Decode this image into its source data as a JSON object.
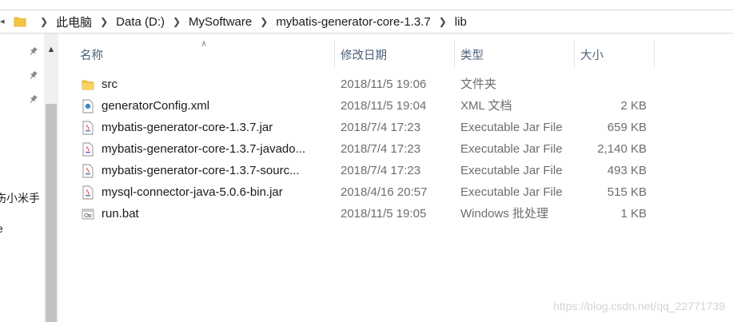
{
  "address_bar": {
    "crumbs": [
      "此电脑",
      "Data (D:)",
      "MySoftware",
      "mybatis-generator-core-1.3.7",
      "lib"
    ]
  },
  "nav": {
    "fragments": [
      "伤小米手",
      "e"
    ]
  },
  "columns": {
    "name": "名称",
    "date": "修改日期",
    "type": "类型",
    "size": "大小"
  },
  "files": [
    {
      "icon": "folder-icon",
      "name": "src",
      "date": "2018/11/5 19:06",
      "type": "文件夹",
      "size": ""
    },
    {
      "icon": "xml-file-icon",
      "name": "generatorConfig.xml",
      "date": "2018/11/5 19:04",
      "type": "XML 文档",
      "size": "2 KB"
    },
    {
      "icon": "jar-file-icon",
      "name": "mybatis-generator-core-1.3.7.jar",
      "date": "2018/7/4 17:23",
      "type": "Executable Jar File",
      "size": "659 KB"
    },
    {
      "icon": "jar-file-icon",
      "name": "mybatis-generator-core-1.3.7-javado...",
      "date": "2018/7/4 17:23",
      "type": "Executable Jar File",
      "size": "2,140 KB"
    },
    {
      "icon": "jar-file-icon",
      "name": "mybatis-generator-core-1.3.7-sourc...",
      "date": "2018/7/4 17:23",
      "type": "Executable Jar File",
      "size": "493 KB"
    },
    {
      "icon": "jar-file-icon",
      "name": "mysql-connector-java-5.0.6-bin.jar",
      "date": "2018/4/16 20:57",
      "type": "Executable Jar File",
      "size": "515 KB"
    },
    {
      "icon": "batch-file-icon",
      "name": "run.bat",
      "date": "2018/11/5 19:05",
      "type": "Windows 批处理",
      "size": "1 KB"
    }
  ],
  "watermark": "https://blog.csdn.net/qq_22771739",
  "colors": {
    "header_text": "#4c607a",
    "secondary_text": "#6d6d6d",
    "folder": "#f4c542"
  }
}
